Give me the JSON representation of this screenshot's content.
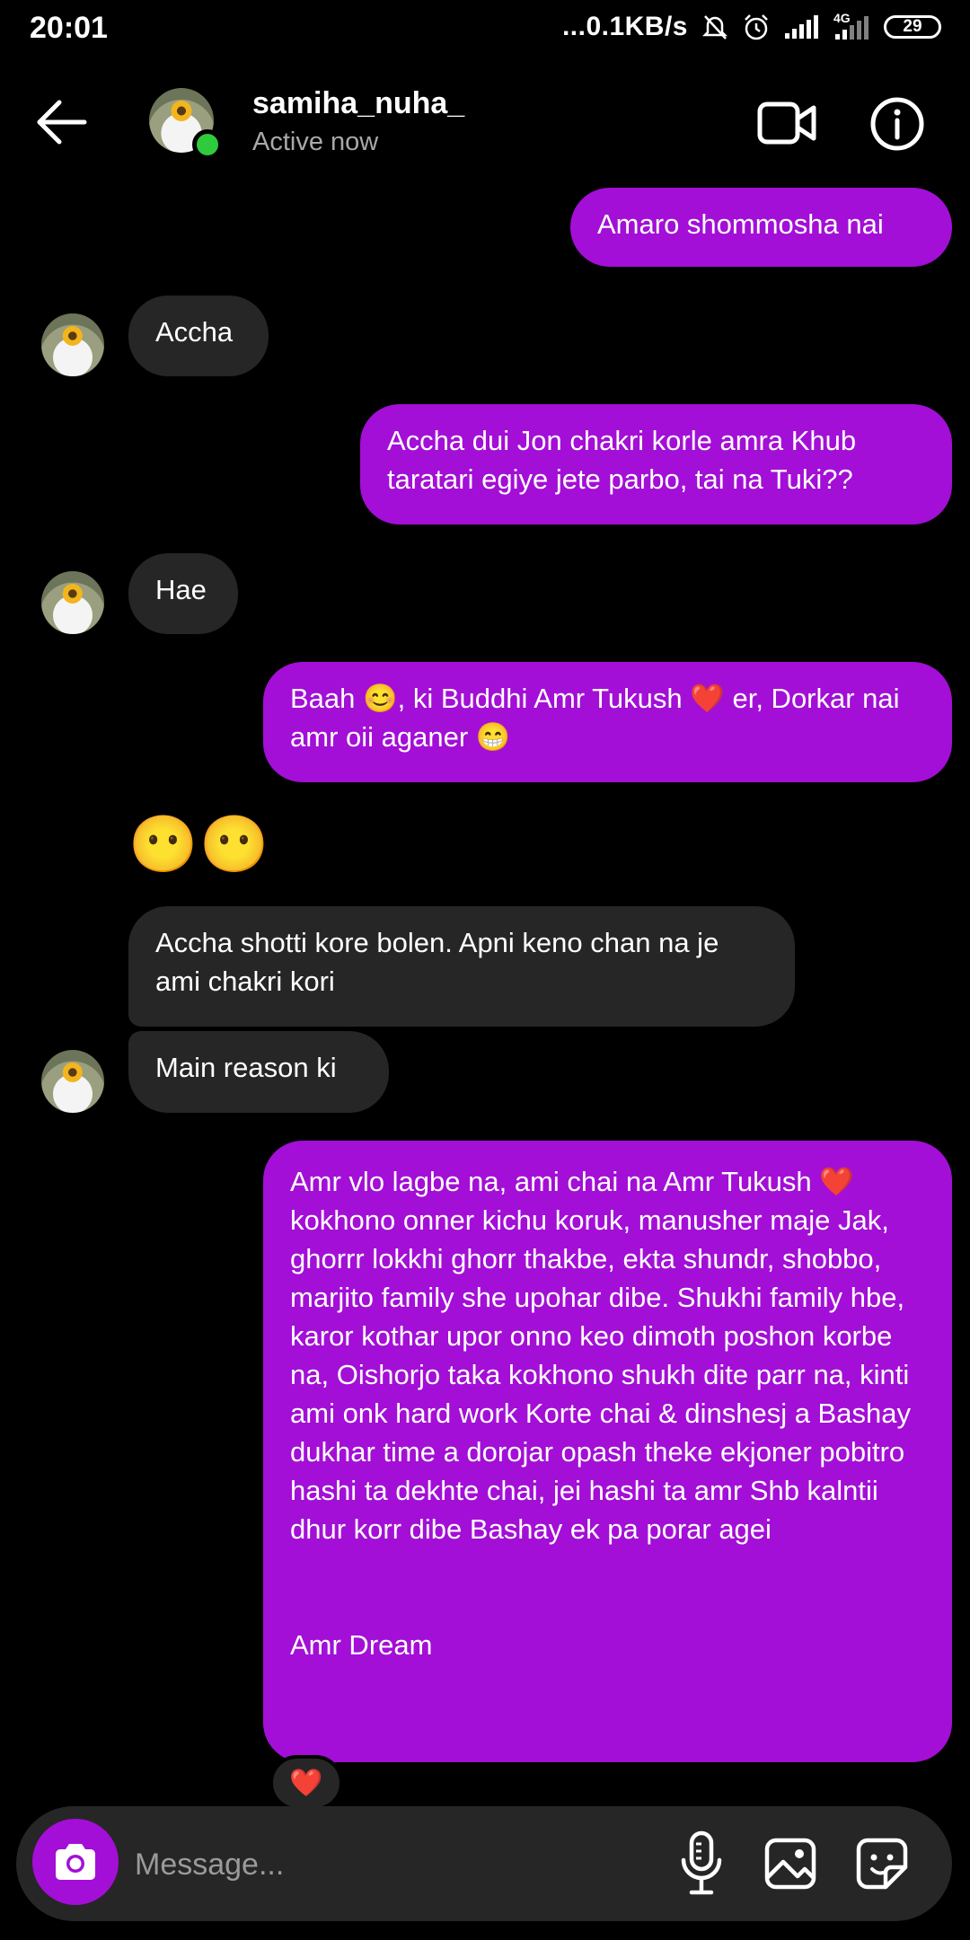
{
  "status_bar": {
    "time": "20:01",
    "net_speed": "...0.1KB/s",
    "network_type": "4G",
    "battery": "29"
  },
  "header": {
    "username": "samiha_nuha_",
    "status": "Active now"
  },
  "messages": [
    {
      "side": "out",
      "text": "Amaro shommosha nai"
    },
    {
      "side": "in",
      "text": "Accha"
    },
    {
      "side": "out",
      "text": "Accha dui Jon chakri korle amra Khub taratari egiye jete parbo, tai na Tuki??"
    },
    {
      "side": "in",
      "text": "Hae"
    },
    {
      "side": "out",
      "text": "Baah 😊, ki Buddhi Amr Tukush ❤️ er, Dorkar nai amr oii aganer 😁"
    },
    {
      "side": "in",
      "text": "😶😶"
    },
    {
      "side": "in",
      "text": "Accha shotti kore bolen. Apni keno chan na je ami chakri kori"
    },
    {
      "side": "in",
      "text": "Main reason ki"
    },
    {
      "side": "out",
      "text": "Amr vlo lagbe na, ami chai na Amr Tukush ❤️ kokhono onner kichu koruk, manusher maje Jak, ghorrr lokkhi ghorr thakbe, ekta shundr, shobbo, marjito family she upohar dibe. Shukhi family hbe, karor kothar upor onno keo dimoth poshon korbe na, Oishorjo taka kokhono shukh dite parr na, kinti ami onk hard work Korte chai & dinshesj a Bashay dukhar time a dorojar opash theke ekjoner pobitro hashi ta dekhte chai, jei hashi ta amr Shb kalntii dhur korr dibe Bashay ek pa porar agei\n\n\nAmr Dream"
    }
  ],
  "reaction": "❤️",
  "composer": {
    "placeholder": "Message..."
  },
  "colors": {
    "outgoing_bubble": "#a30fd6",
    "incoming_bubble": "#262626",
    "online": "#2fcb3c",
    "background": "#000000"
  },
  "icons": {
    "back": "arrow-left-icon",
    "video": "video-camera-icon",
    "info": "info-icon",
    "camera": "camera-icon",
    "mic": "microphone-icon",
    "gallery": "image-icon",
    "sticker": "sticker-icon"
  }
}
